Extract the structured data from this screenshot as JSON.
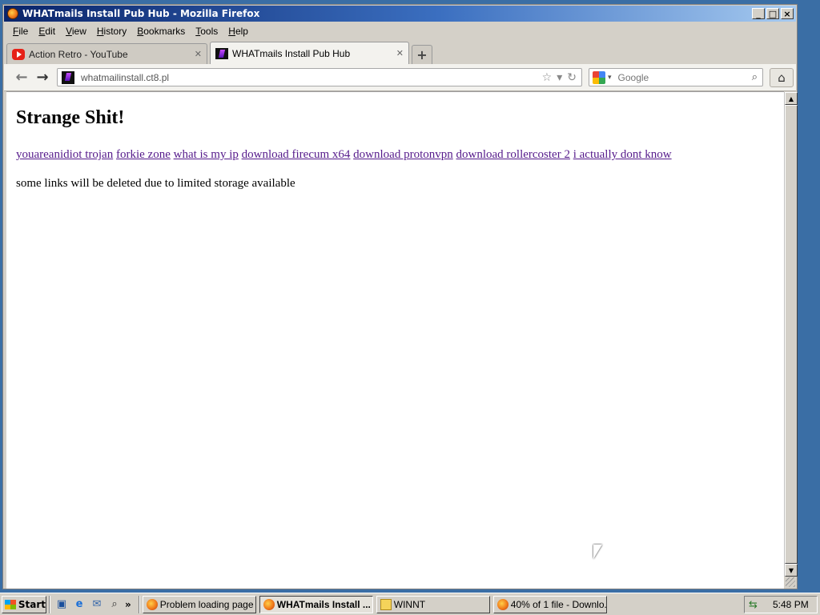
{
  "window": {
    "title": "WHATmails Install Pub Hub - Mozilla Firefox"
  },
  "menu": [
    "File",
    "Edit",
    "View",
    "History",
    "Bookmarks",
    "Tools",
    "Help"
  ],
  "tabs": [
    {
      "label": "Action Retro - YouTube",
      "icon": "youtube-icon",
      "active": false
    },
    {
      "label": "WHATmails Install Pub Hub",
      "icon": "site-icon",
      "active": true
    }
  ],
  "nav": {
    "url": "whatmailinstall.ct8.pl",
    "search_placeholder": "Google"
  },
  "page": {
    "heading": "Strange Shit!",
    "links": [
      "youareanidiot trojan",
      "forkie zone",
      "what is my ip",
      "download firecum x64",
      "download protonvpn",
      "download rollercoster 2",
      "i actually dont know"
    ],
    "note": "some links will be deleted due to limited storage available"
  },
  "taskbar": {
    "start_label": "Start",
    "tasks": [
      {
        "label": "Problem loading page ...",
        "icon": "firefox-icon",
        "active": false
      },
      {
        "label": "WHATmails Install ...",
        "icon": "firefox-icon",
        "active": true
      },
      {
        "label": "WINNT",
        "icon": "folder-icon",
        "active": false
      },
      {
        "label": "40% of 1 file - Downlo...",
        "icon": "firefox-icon",
        "active": false
      }
    ],
    "clock": "5:48 PM"
  },
  "colors": {
    "titlebar_start": "#0a246a",
    "link_visited": "#551a8b",
    "desktop": "#3a6ea5"
  }
}
